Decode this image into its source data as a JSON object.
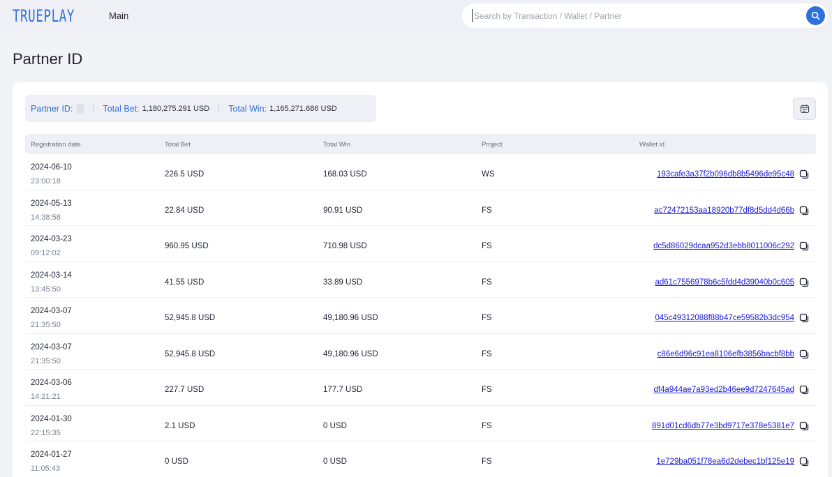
{
  "header": {
    "logo": "TRUEPLAY",
    "nav_main": "Main",
    "search_placeholder": "Search by Transaction / Wallet / Partner"
  },
  "page": {
    "title": "Partner ID"
  },
  "summary": {
    "partner_label": "Partner ID:",
    "total_bet_label": "Total Bet:",
    "total_bet_value": "1,180,275.291 USD",
    "total_win_label": "Total Win:",
    "total_win_value": "1,165,271.686 USD"
  },
  "table": {
    "columns": [
      "Registration date",
      "Total Bet",
      "Total Win",
      "Project",
      "Wallet id"
    ],
    "rows": [
      {
        "date": "2024-06-10",
        "time": "23:00:18",
        "bet": "226.5 USD",
        "win": "168.03 USD",
        "project": "WS",
        "wallet": "193cafe3a37f2b096db8b5496de95c48"
      },
      {
        "date": "2024-05-13",
        "time": "14:38:58",
        "bet": "22.84 USD",
        "win": "90.91 USD",
        "project": "FS",
        "wallet": "ac72472153aa18920b77df8d5dd4d66b"
      },
      {
        "date": "2024-03-23",
        "time": "09:12:02",
        "bet": "960.95 USD",
        "win": "710.98 USD",
        "project": "FS",
        "wallet": "dc5d86029dcaa952d3ebb8011006c292"
      },
      {
        "date": "2024-03-14",
        "time": "13:45:50",
        "bet": "41.55 USD",
        "win": "33.89 USD",
        "project": "FS",
        "wallet": "ad61c7556978b6c5fdd4d39040b0c605"
      },
      {
        "date": "2024-03-07",
        "time": "21:35:50",
        "bet": "52,945.8 USD",
        "win": "49,180.96 USD",
        "project": "FS",
        "wallet": "045c49312088f88b47ce59582b3dc954"
      },
      {
        "date": "2024-03-07",
        "time": "21:35:50",
        "bet": "52,945.8 USD",
        "win": "49,180.96 USD",
        "project": "FS",
        "wallet": "c86e6d96c91ea8106efb3856bacbf8bb"
      },
      {
        "date": "2024-03-06",
        "time": "14:21:21",
        "bet": "227.7 USD",
        "win": "177.7 USD",
        "project": "FS",
        "wallet": "df4a944ae7a93ed2b46ee9d7247645ad"
      },
      {
        "date": "2024-01-30",
        "time": "22:15:35",
        "bet": "2.1 USD",
        "win": "0 USD",
        "project": "FS",
        "wallet": "891d01cd6db77e3bd9717e378e5381e7"
      },
      {
        "date": "2024-01-27",
        "time": "11:05:43",
        "bet": "0 USD",
        "win": "0 USD",
        "project": "FS",
        "wallet": "1e729ba051f78ea6d2debec1bf125e19"
      }
    ]
  },
  "icons": {
    "search": "search-icon",
    "calendar": "calendar-icon",
    "copy": "copy-icon"
  },
  "colors": {
    "accent": "#2e6fdc",
    "link": "#1a1ad6"
  }
}
